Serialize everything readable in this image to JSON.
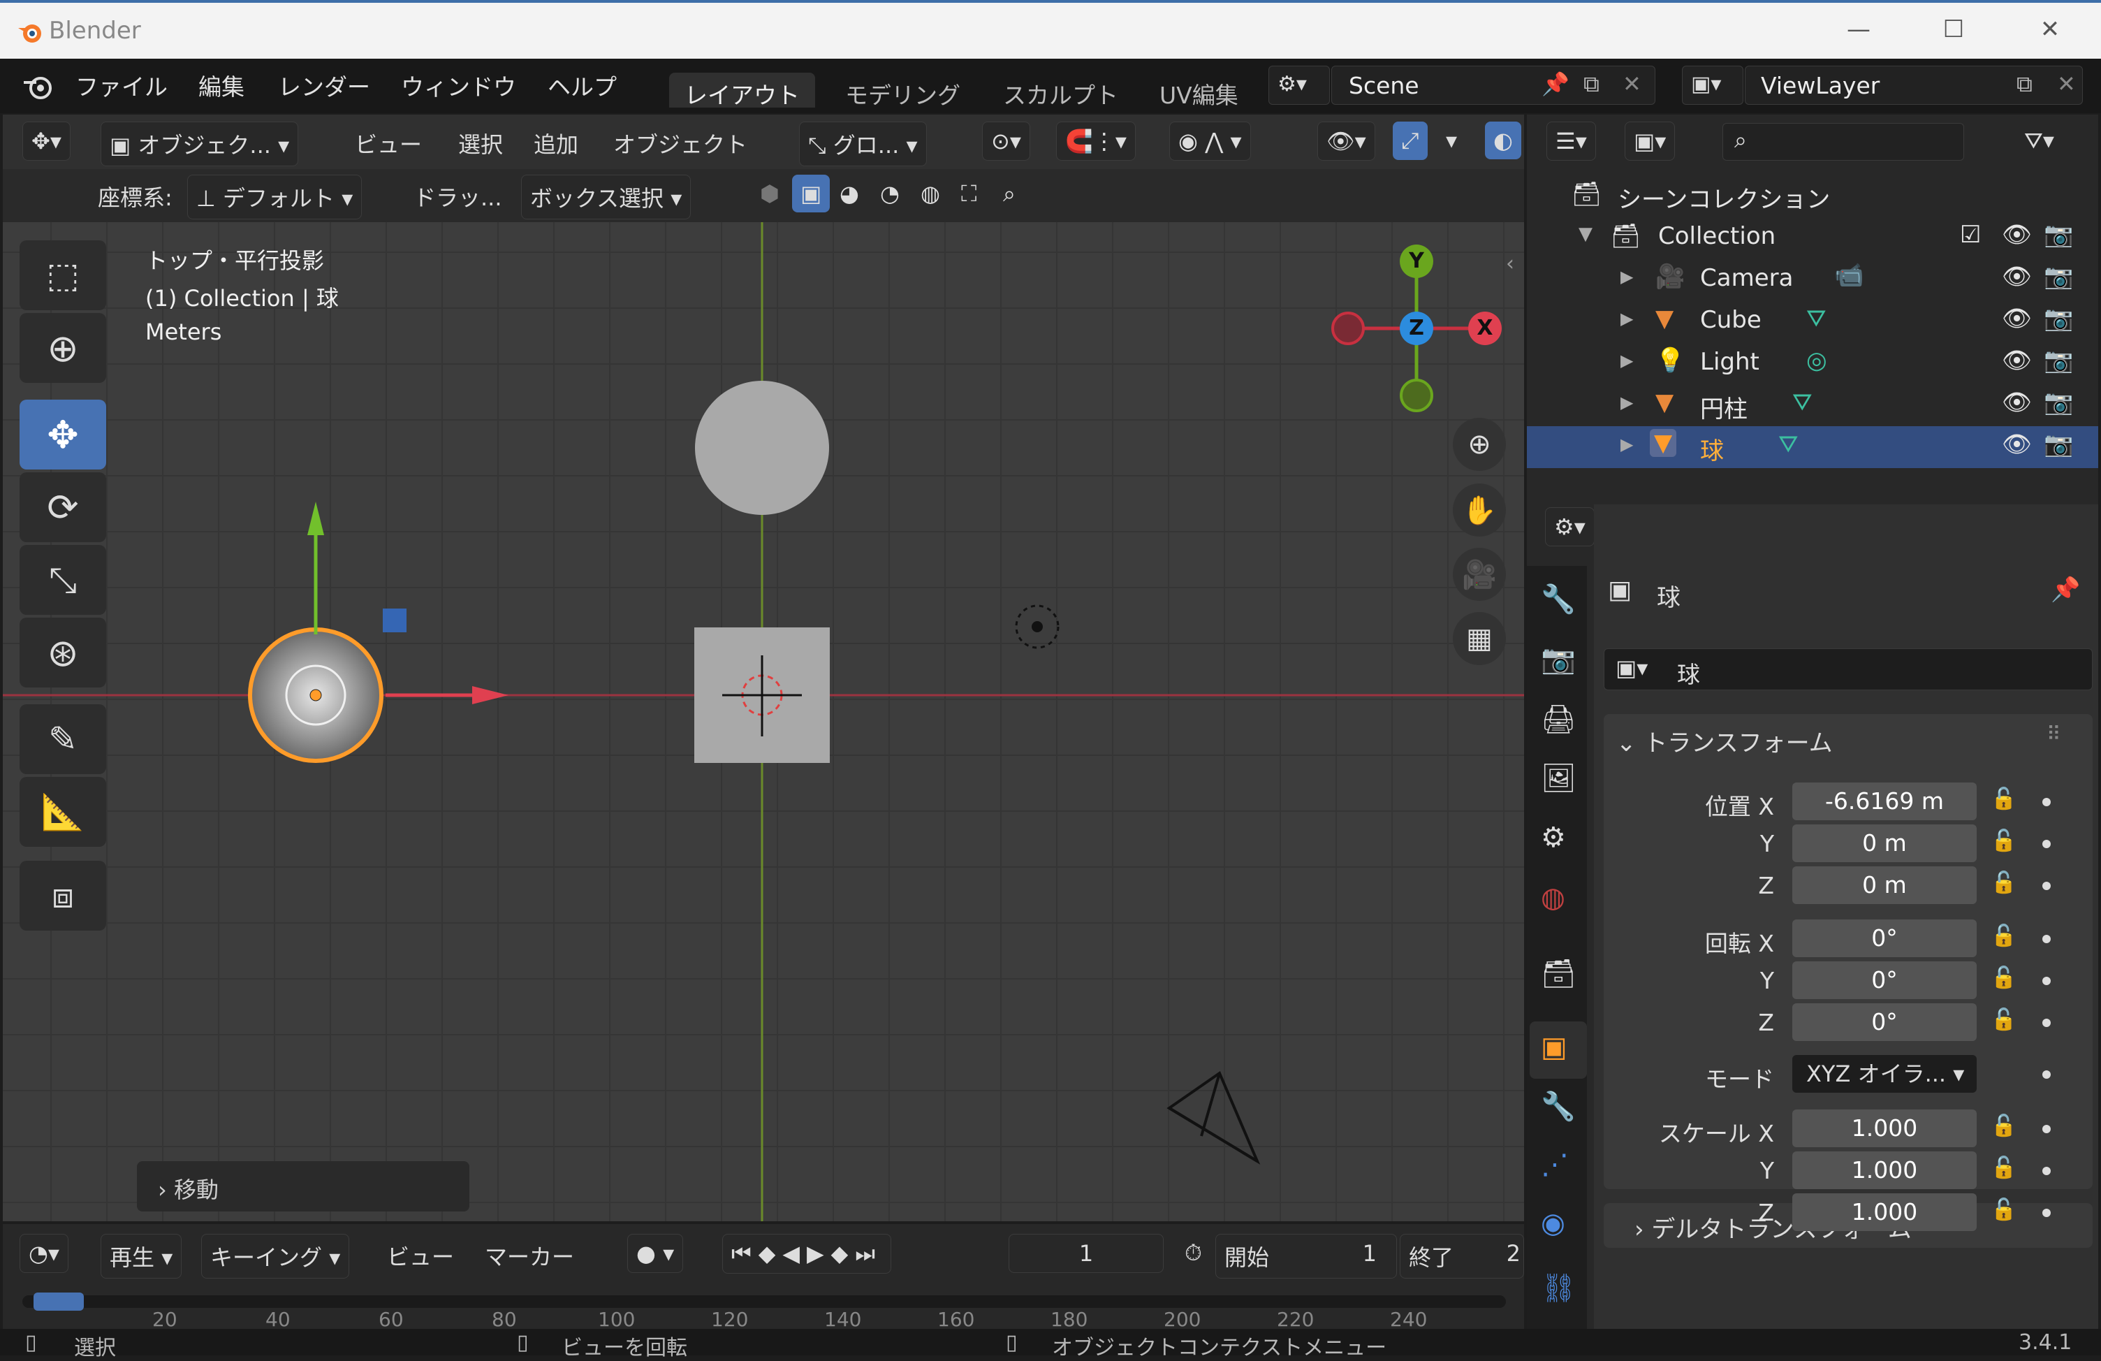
{
  "window": {
    "app_title": "Blender",
    "minimize": "—",
    "maximize": "☐",
    "close": "✕"
  },
  "menu": [
    "ファイル",
    "編集",
    "レンダー",
    "ウィンドウ",
    "ヘルプ"
  ],
  "workspaces": [
    "レイアウト",
    "モデリング",
    "スカルプト",
    "UV編集"
  ],
  "scene": {
    "label": "Scene"
  },
  "view_layer": {
    "label": "ViewLayer"
  },
  "viewport_header": {
    "mode": "オブジェク...",
    "menus": [
      "ビュー",
      "選択",
      "追加",
      "オブジェクト"
    ],
    "transform_orientation": "グロ..."
  },
  "tool_settings": {
    "coord_label": "座標系:",
    "coord_value": "デフォルト",
    "drag_label": "ドラッ...",
    "drag_value": "ボックス選択"
  },
  "viewport_info": {
    "line1": "トップ・平行投影",
    "line2": "(1) Collection | 球",
    "line3": "Meters"
  },
  "gizmo": {
    "y": "Y",
    "z": "Z",
    "x": "X"
  },
  "last_operator": "移動",
  "timeline": {
    "playback": "再生",
    "keying": "キーイング",
    "view": "ビュー",
    "marker": "マーカー",
    "current_frame": "1",
    "start_label": "開始",
    "start_value": "1",
    "end_label": "終了",
    "end_value": "2",
    "ruler": [
      "20",
      "40",
      "60",
      "80",
      "100",
      "120",
      "140",
      "160",
      "180",
      "200",
      "220",
      "240"
    ]
  },
  "status": {
    "select": "選択",
    "rotate": "ビューを回転",
    "context": "オブジェクトコンテクストメニュー",
    "version": "3.4.1"
  },
  "outliner": {
    "scene_collection": "シーンコレクション",
    "collection": "Collection",
    "items": [
      {
        "name": "Camera",
        "type": "camera"
      },
      {
        "name": "Cube",
        "type": "mesh"
      },
      {
        "name": "Light",
        "type": "light"
      },
      {
        "name": "円柱",
        "type": "mesh"
      },
      {
        "name": "球",
        "type": "mesh",
        "selected": true
      }
    ]
  },
  "properties": {
    "object_name": "球",
    "object_field": "球",
    "transform_header": "トランスフォーム",
    "location_label": "位置 X",
    "loc": [
      "-6.6169 m",
      "0 m",
      "0 m"
    ],
    "rotation_label": "回転 X",
    "rot": [
      "0°",
      "0°",
      "0°"
    ],
    "mode_label": "モード",
    "mode_value": "XYZ オイラ...",
    "scale_label": "スケール X",
    "scale": [
      "1.000",
      "1.000",
      "1.000"
    ],
    "axis_y": "Y",
    "axis_z": "Z",
    "delta_header": "デルタトランスフォーム"
  },
  "colors": {
    "accent": "#4772b3",
    "selection_orange": "#ffa033",
    "x_axis": "#e04050",
    "y_axis": "#6aa61e",
    "z_axis": "#2c8cde"
  }
}
